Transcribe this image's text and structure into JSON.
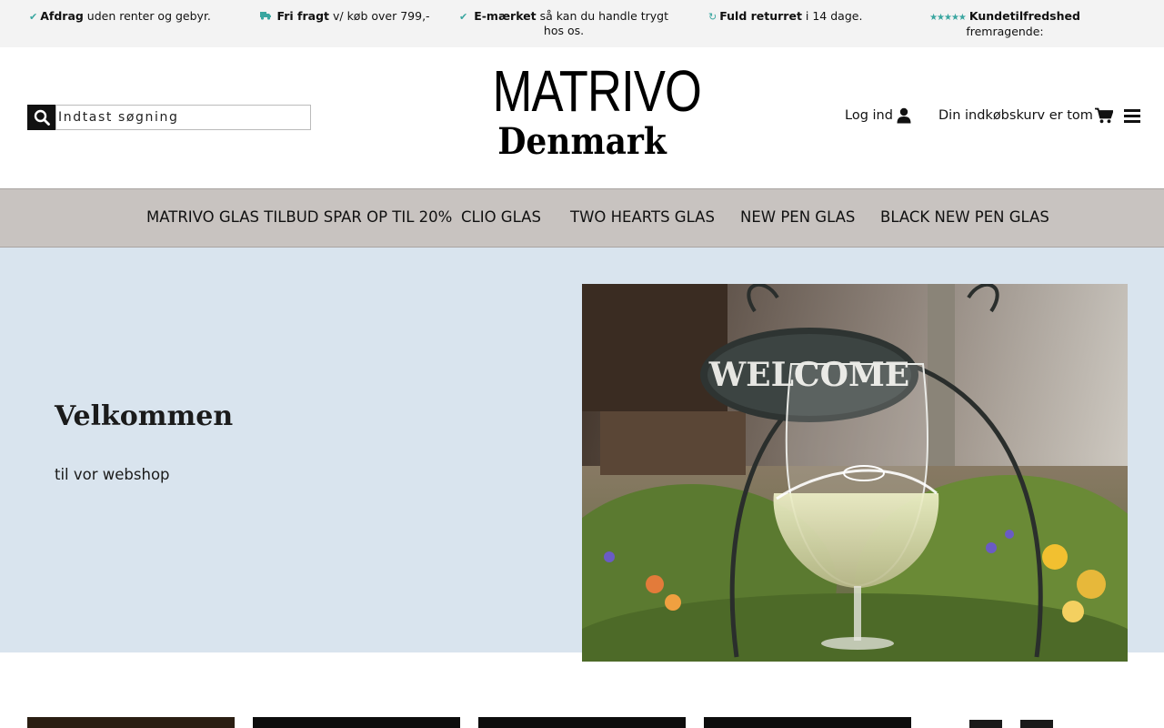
{
  "usp": [
    {
      "icon": "check-icon",
      "bold": "Afdrag",
      "text": " uden renter og gebyr."
    },
    {
      "icon": "truck-icon",
      "bold": "Fri fragt",
      "text": " v/ køb over 799,-"
    },
    {
      "icon": "check-icon",
      "bold": "E-mærket",
      "text": " så kan du handle trygt hos os."
    },
    {
      "icon": "refresh-icon",
      "bold": "Fuld returret",
      "text": " i 14 dage."
    },
    {
      "icon": "star-rating-icon",
      "bold": "Kundetilfredshed",
      "text": "fremragende:"
    }
  ],
  "search": {
    "placeholder": "Indtast søgning"
  },
  "logo": {
    "top": "MATRIVO",
    "bottom": "Denmark"
  },
  "header": {
    "login_label": "Log ind",
    "cart_label": "Din indkøbskurv er tom"
  },
  "nav": [
    {
      "label": "MATRIVO GLAS TILBUD SPAR OP TIL 20%"
    },
    {
      "label": "CLIO GLAS"
    },
    {
      "label": "TWO HEARTS GLAS"
    },
    {
      "label": "NEW PEN GLAS"
    },
    {
      "label": "BLACK NEW PEN GLAS"
    }
  ],
  "hero": {
    "title": "Velkommen",
    "subtitle": "til vor webshop",
    "sign_text": "WELCOME"
  },
  "colors": {
    "accent": "#3aa6a0",
    "nav_bg": "#c8c3c0",
    "hero_bg": "#d9e4ee",
    "topbar_bg": "#f3f3f3"
  }
}
